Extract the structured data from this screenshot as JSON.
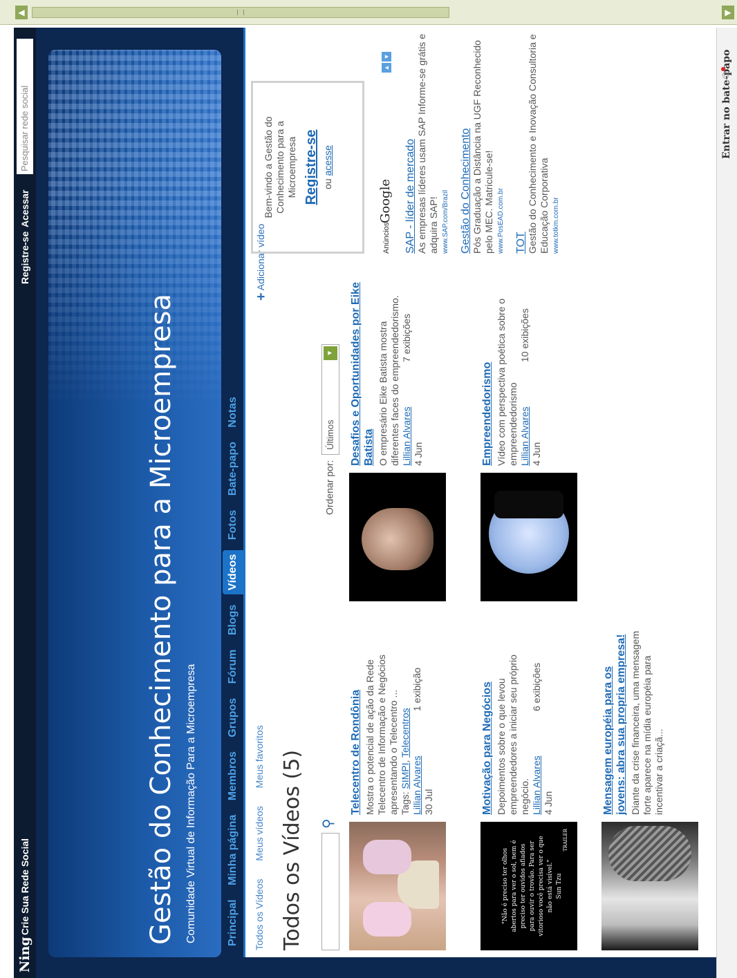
{
  "ning_bar": {
    "logo": "Ning",
    "crie": "Crie Sua Rede Social",
    "register": "Registre-se",
    "login": "Acessar",
    "search_placeholder": "Pesquisar rede social"
  },
  "banner": {
    "title": "Gestão do Conhecimento para a Microempresa",
    "subtitle": "Comunidade Virtual de Informação Para a Microempresa"
  },
  "nav": {
    "tabs": [
      "Principal",
      "Minha página",
      "Membros",
      "Grupos",
      "Fórum",
      "Blogs",
      "Vídeos",
      "Fotos",
      "Bate-papo",
      "Notas"
    ],
    "active": "Vídeos"
  },
  "subnav": {
    "all": "Todos os Vídeos",
    "mine": "Meus vídeos",
    "favorites": "Meus favoritos",
    "add": "Adicionar vídeo"
  },
  "page_title": "Todos os Vídeos (5)",
  "sort": {
    "label": "Ordenar por:",
    "value": "Últimos"
  },
  "videos": [
    {
      "title": "Telecentro de Rondônia",
      "desc": "Mostra o potencial de ação da Rede Telecentro de Informação e Negócios apresentando o Telecentro ...",
      "tags_label": "Tags:",
      "tag1": "SIMPI",
      "tag2": "Telecentros",
      "author": "Lillian Alvares",
      "views": "1 exibição",
      "date": "30 Jul"
    },
    {
      "title": "Desafios e Oportunidades por Eike Batista",
      "desc": "O empresário Eike Batista mostra diferentes faces do empreendedorismo.",
      "author": "Lillian Alvares",
      "views": "7 exibições",
      "date": "4 Jun"
    },
    {
      "title": "Motivação para Negócios",
      "desc": "Depoimentos sobre o que levou empreendedores a iniciar seu próprio negócio.",
      "author": "Lillian Alvares",
      "views": "6 exibições",
      "date": "4 Jun",
      "thumb_text": "\"Não é preciso ter olhos abertos para ver o sol, nem é preciso ter ouvidos afiados para ouvir o trovão. Para ser vitorioso você precisa ver o que não está visível.\"",
      "thumb_author": "Sun Tzu",
      "thumb_trailer": "TRAILER"
    },
    {
      "title": "Empreendedorismo",
      "desc": "Vídeo com perspectiva poética sobre o empreendedorismo",
      "author": "Lillian Alvares",
      "views": "10 exibições",
      "date": "4 Jun"
    },
    {
      "title": "Mensagem européia para os jovens: abra sua propria empresa!",
      "desc": "Diante da crise financeira, uma mensagem forte aparece na mídia européia para incentivar a criaçã..."
    }
  ],
  "welcome": {
    "text": "Bem-vindo a Gestão do Conhecimento para a Microempresa",
    "register": "Registre-se",
    "or": "ou",
    "login": "acesse"
  },
  "ads": {
    "label": "Anúncios",
    "brand": "Google",
    "items": [
      {
        "title": "SAP - líder de mercado",
        "text": "As empresas líderes usam SAP Informe-se grátis e adquira SAP!",
        "url": "www.SAP.com/Brazil"
      },
      {
        "title": "Gestão do Conhecimento",
        "text": "Pós Graduação a Distância na UGF Reconhecido pelo MEC. Matricule-se!",
        "url": "www.PosEAD.com.br"
      },
      {
        "title": "TOT",
        "text": "Gestão do Conhecimento e Inovação Consultoria e Educação Corporativa",
        "url": "www.totkm.com.br"
      }
    ]
  },
  "chat": {
    "label": "Entrar no bate-papo"
  }
}
